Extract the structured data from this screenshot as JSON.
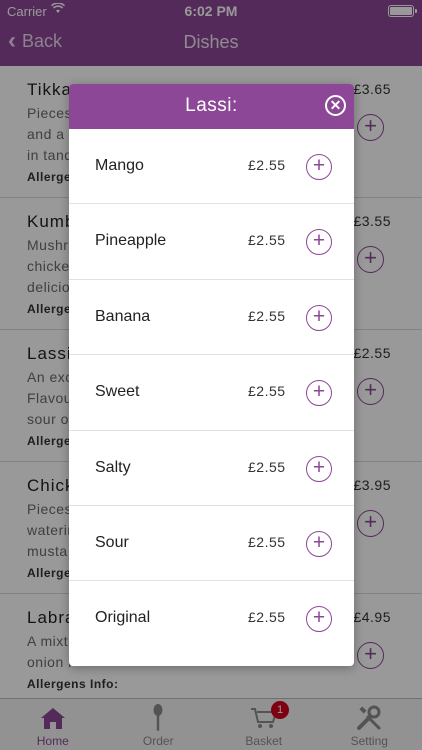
{
  "status": {
    "carrier": "Carrier",
    "time": "6:02 PM"
  },
  "nav": {
    "back_label": "Back",
    "title": "Dishes"
  },
  "list": {
    "items": [
      {
        "name": "Tikka",
        "desc1": "Pieces",
        "desc2": "and a s",
        "desc3": "in tand",
        "allergens": "Allerge",
        "price": "£3.65"
      },
      {
        "name": "Kumb",
        "desc1": "Mushro",
        "desc2": "chicke",
        "desc3": "delicio",
        "allergens": "Allerge",
        "price": "£3.55"
      },
      {
        "name": "Lassi",
        "desc1": "An exo",
        "desc2": "Flavou",
        "desc3": "sour o",
        "allergens": "Allerge",
        "price": "£2.55"
      },
      {
        "name": "Chick",
        "desc1": "Pieces",
        "desc2": "waterin",
        "desc3": "musta",
        "allergens": "Allerge",
        "price": "£3.95"
      },
      {
        "name": "Labra",
        "desc1": "A mixt",
        "desc2": "onion l",
        "desc3": "",
        "allergens": "Allergens Info:",
        "price": "£4.95"
      }
    ]
  },
  "modal": {
    "title": "Lassi:",
    "options": [
      {
        "name": "Mango",
        "price": "£2.55"
      },
      {
        "name": "Pineapple",
        "price": "£2.55"
      },
      {
        "name": "Banana",
        "price": "£2.55"
      },
      {
        "name": "Sweet",
        "price": "£2.55"
      },
      {
        "name": "Salty",
        "price": "£2.55"
      },
      {
        "name": "Sour",
        "price": "£2.55"
      },
      {
        "name": "Original",
        "price": "£2.55"
      }
    ]
  },
  "tabbar": {
    "home": "Home",
    "order": "Order",
    "basket": "Basket",
    "basket_badge": "1",
    "setting": "Setting"
  },
  "colors": {
    "brand": "#8d4797",
    "badge": "#d0021b"
  }
}
